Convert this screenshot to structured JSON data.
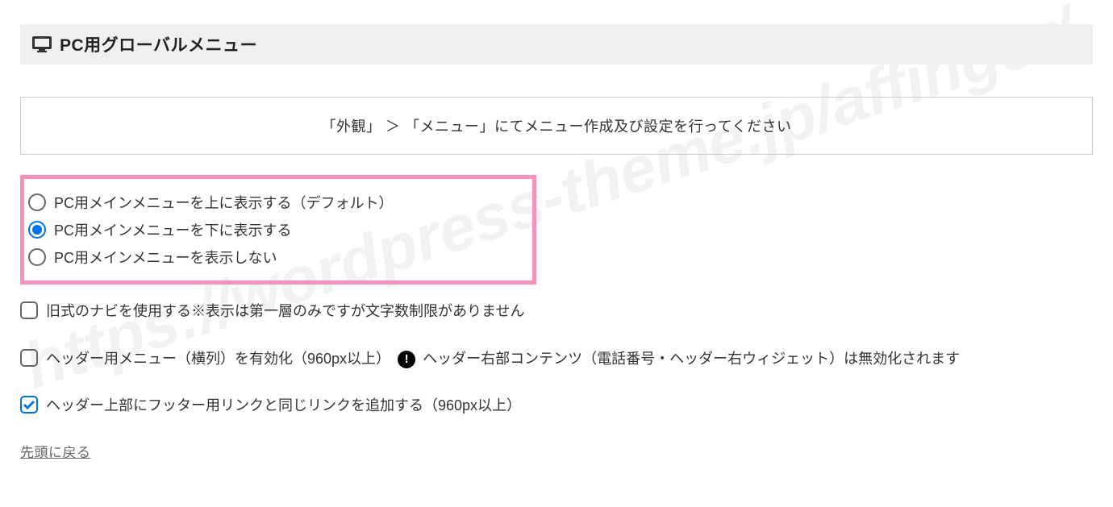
{
  "watermark": "https://wordpress-theme.jp/affinger/",
  "section": {
    "title": "PC用グローバルメニュー"
  },
  "notice": "「外観」 ＞ 「メニュー」にてメニュー作成及び設定を行ってください",
  "radios": {
    "option1": "PC用メインメニューを上に表示する（デフォルト）",
    "option2": "PC用メインメニューを下に表示する",
    "option3": "PC用メインメニューを表示しない"
  },
  "checkboxes": {
    "legacy_nav": "旧式のナビを使用する※表示は第一層のみですが文字数制限がありません",
    "header_menu_part1": "ヘッダー用メニュー（横列）を有効化（960px以上）",
    "header_menu_part2": "ヘッダー右部コンテンツ（電話番号・ヘッダー右ウィジェット）は無効化されます",
    "footer_link": "ヘッダー上部にフッター用リンクと同じリンクを追加する（960px以上）"
  },
  "back_link": "先頭に戻る"
}
